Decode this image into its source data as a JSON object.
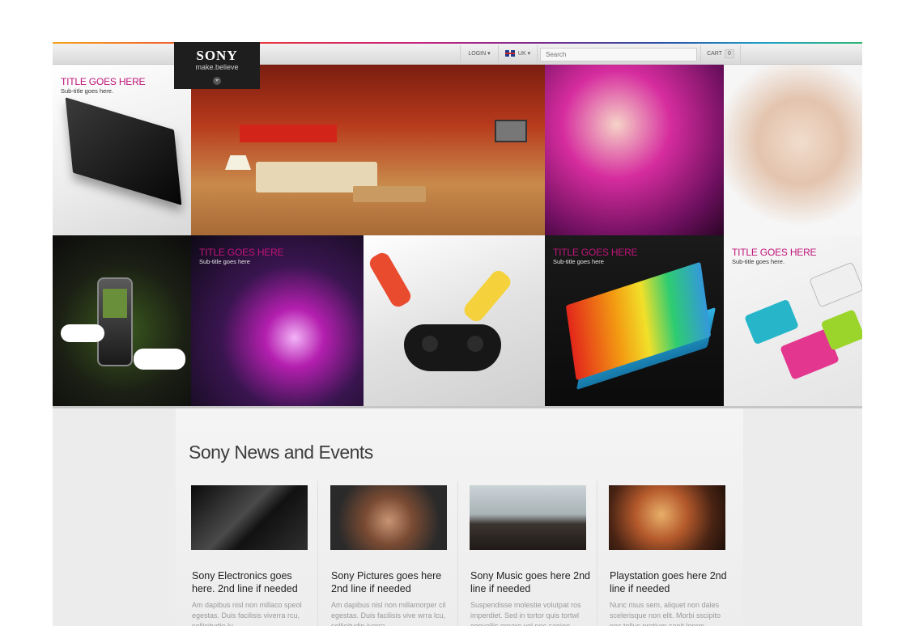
{
  "header": {
    "logo_brand": "SONY",
    "logo_tagline": "make.believe",
    "login_label": "LOGIN ▾",
    "language_label": "UK ▾",
    "search_placeholder": "Search",
    "cart_label": "CART",
    "cart_count": "0"
  },
  "hero_tiles": [
    {
      "title": "TITLE GOES HERE",
      "subtitle": "Sub-title goes here."
    },
    {
      "title": "TITLE GOES HERE",
      "subtitle": "Sub-title goes here"
    },
    {
      "title": "TITLE GOES HERE",
      "subtitle": "Sub-title goes here"
    },
    {
      "title": "TITLE GOES HERE",
      "subtitle": "Sub-title goes here."
    }
  ],
  "news": {
    "heading": "Sony News and Events",
    "cards": [
      {
        "title": "Sony Electronics goes here. 2nd line if needed",
        "text": "Am dapibus nisl non millaco speol egestas. Duis facilisis viverra rcu, sollicitudin lu ..."
      },
      {
        "title": "Sony Pictures goes here 2nd line if needed",
        "text": "Am dapibus nisl non millamorper cil egestas. Duis facilisis vive wrra lcu, sollicitudin ivarra ..."
      },
      {
        "title": "Sony Music goes here 2nd line if needed",
        "text": "Suspendisse molestie volutpat ros imperdiet. Sed in tortor quis tortwl convallis ornare vel nec sapien ..."
      },
      {
        "title": "Playstation goes here 2nd line if needed",
        "text": "Nunc risus sem, aliquet non dales scelerisque non elit. Morbi sscipito nec tellus pretium sapit lorem ..."
      }
    ]
  },
  "colors": {
    "accent_magenta": "#c0157a",
    "logo_bg": "#1e1e1e"
  }
}
